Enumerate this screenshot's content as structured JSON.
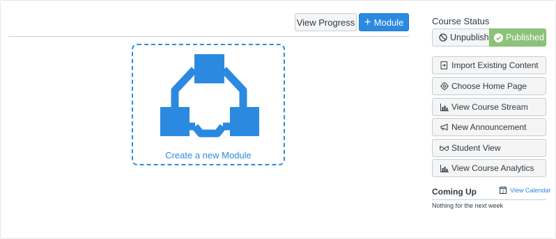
{
  "header": {
    "view_progress_label": "View Progress",
    "add_module_label": "Module",
    "add_module_icon": "plus-icon"
  },
  "main": {
    "create_module_label": "Create a new Module",
    "create_module_icon": "module-diagram-icon"
  },
  "sidebar": {
    "course_status_title": "Course Status",
    "unpublish_label": "Unpublish",
    "published_label": "Published",
    "actions": [
      {
        "label": "Import Existing Content",
        "icon": "import-icon"
      },
      {
        "label": "Choose Home Page",
        "icon": "target-icon"
      },
      {
        "label": "View Course Stream",
        "icon": "stream-chart-icon"
      },
      {
        "label": "New Announcement",
        "icon": "megaphone-icon"
      },
      {
        "label": "Student View",
        "icon": "glasses-icon"
      },
      {
        "label": "View Course Analytics",
        "icon": "analytics-chart-icon"
      }
    ],
    "coming_up": {
      "title": "Coming Up",
      "view_calendar_label": "View Calendar",
      "empty_message": "Nothing for the next week"
    }
  },
  "colors": {
    "accent": "#2b8ae0",
    "published": "#8cc37a",
    "text": "#2d3b45",
    "border": "#c7cdd1"
  }
}
